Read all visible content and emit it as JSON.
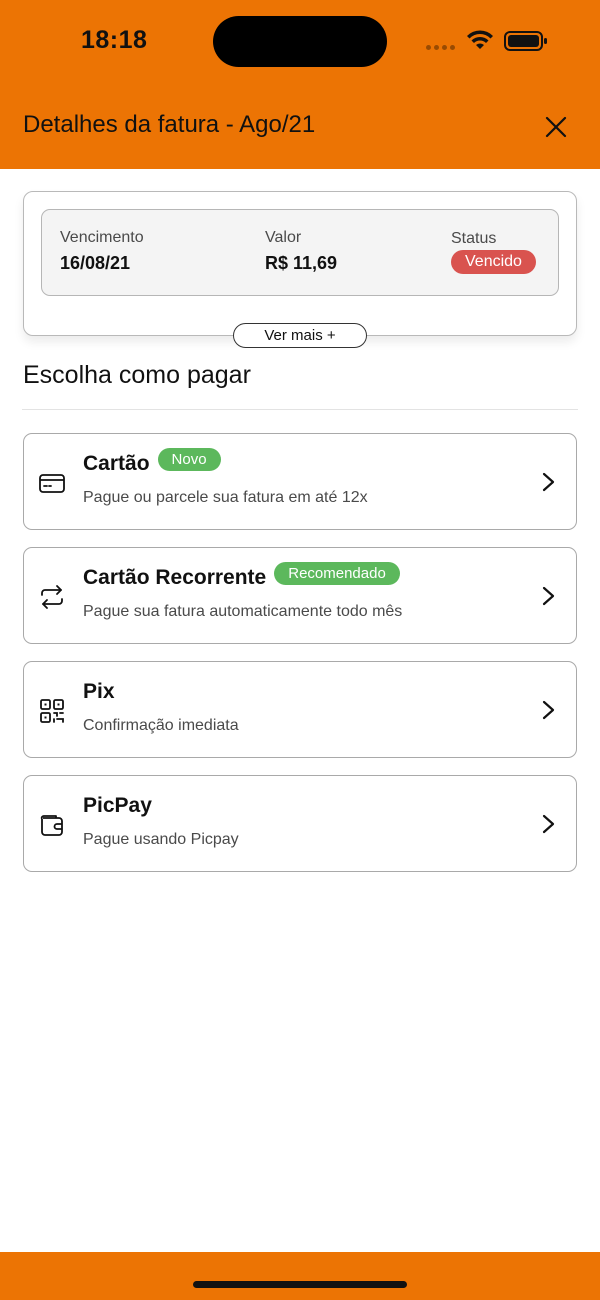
{
  "status_bar": {
    "time": "18:18"
  },
  "header": {
    "title": "Detalhes da fatura - Ago/21"
  },
  "summary": {
    "due_label": "Vencimento",
    "due_value": "16/08/21",
    "amount_label": "Valor",
    "amount_value": "R$ 11,69",
    "status_label": "Status",
    "status_value": "Vencido",
    "more_button": "Ver mais +"
  },
  "payment": {
    "section_title": "Escolha como pagar",
    "options": [
      {
        "title": "Cartão",
        "badge": "Novo",
        "subtitle": "Pague ou parcele sua fatura em até 12x",
        "icon": "credit-card-icon"
      },
      {
        "title": "Cartão Recorrente",
        "badge": "Recomendado",
        "subtitle": "Pague sua fatura automaticamente todo mês",
        "icon": "repeat-icon"
      },
      {
        "title": "Pix",
        "subtitle": "Confirmação imediata",
        "icon": "qr-code-icon"
      },
      {
        "title": "PicPay",
        "subtitle": "Pague usando Picpay",
        "icon": "wallet-icon"
      }
    ]
  },
  "colors": {
    "brand_orange": "#EC7404",
    "badge_red": "#D9534F",
    "badge_green": "#5CB85C"
  }
}
